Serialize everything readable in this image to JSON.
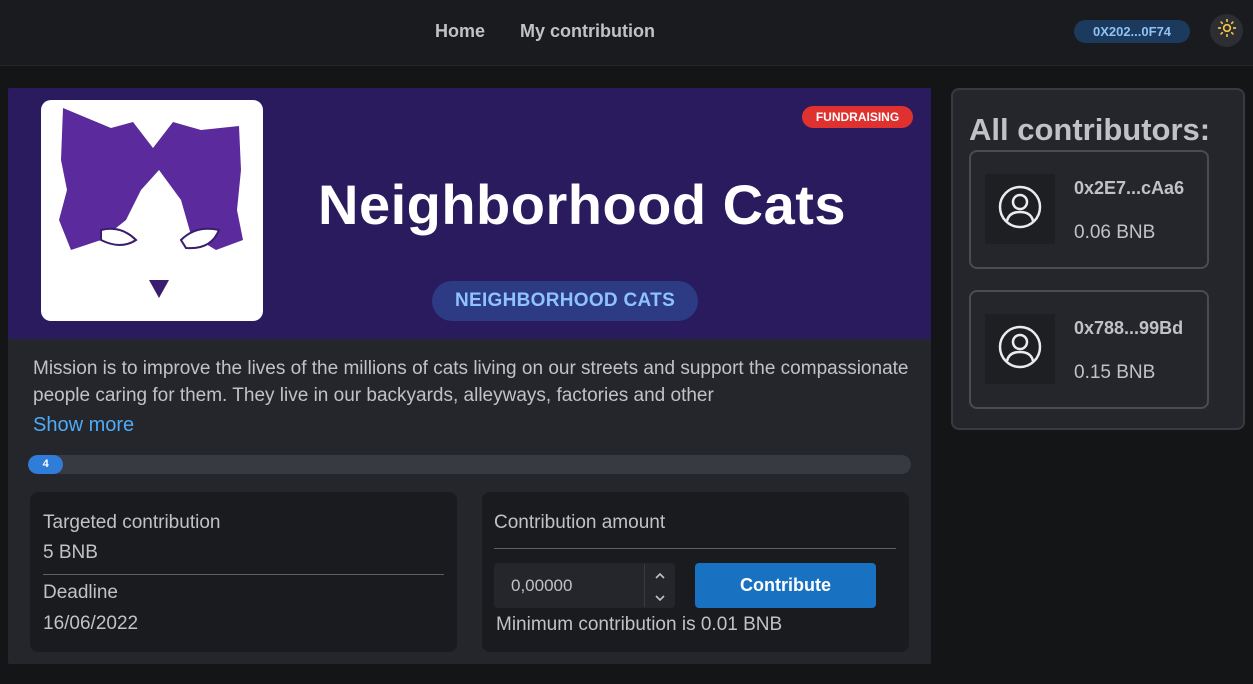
{
  "nav": {
    "home": "Home",
    "my_contribution": "My contribution",
    "wallet": "0X202...0F74",
    "theme_icon": "sun-icon"
  },
  "campaign": {
    "status": "FUNDRAISING",
    "banner_title": "Neighborhood Cats",
    "banner_pill": "NEIGHBORHOOD CATS",
    "description": "Mission is to improve the lives of the millions of cats living on our streets and support the compassionate people caring for them. They live in our backyards, alleyways, factories and other",
    "show_more": "Show more",
    "progress_label": "4",
    "progress_percent": 4,
    "targeted_label": "Targeted contribution",
    "targeted_value": "5 BNB",
    "deadline_label": "Deadline",
    "deadline_value": "16/06/2022"
  },
  "contribute": {
    "label": "Contribution amount",
    "input_value": "0,00000",
    "button": "Contribute",
    "minimum_note": "Minimum contribution is 0.01 BNB"
  },
  "contributors": {
    "title": "All contributors:",
    "items": [
      {
        "address": "0x2E7...cAa6",
        "amount": "0.06 BNB"
      },
      {
        "address": "0x788...99Bd",
        "amount": "0.15 BNB"
      }
    ]
  },
  "colors": {
    "banner_bg": "#2a1a5e",
    "accent": "#1971c2",
    "badge_red": "#e03131"
  }
}
